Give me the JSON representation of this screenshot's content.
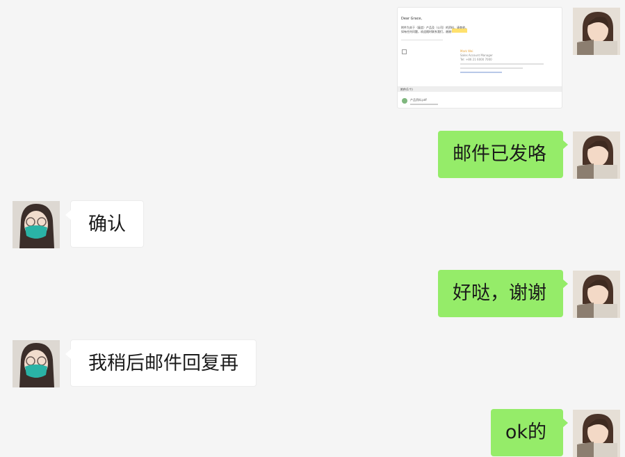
{
  "chat": {
    "messages": [
      {
        "side": "out",
        "type": "image",
        "email": {
          "greeting": "Dear Grace,",
          "body_line_1": "附件为关于（展会）产品及（公司）的资料，请查收。",
          "body_line_2": "如有任何问题，欢迎随时联系我们，谢谢！",
          "signature_name": "Mark Wei",
          "signature_line_1": "Sales Account Manager",
          "signature_line_2": "Tel: +86 21 6000 7000",
          "attachments_header": "附件(1个)",
          "attachment_name": "产品资料.pdf"
        }
      },
      {
        "side": "out",
        "type": "text",
        "text": "邮件已发咯"
      },
      {
        "side": "in",
        "type": "text",
        "text": "确认"
      },
      {
        "side": "out",
        "type": "text",
        "text": "好哒，谢谢"
      },
      {
        "side": "in",
        "type": "text",
        "text": "我稍后邮件回复再"
      },
      {
        "side": "out",
        "type": "text",
        "text": "ok的"
      }
    ]
  },
  "colors": {
    "background": "#f5f5f5",
    "outgoing_bubble": "#95ec69",
    "incoming_bubble": "#ffffff",
    "mask": "#2ab3a6"
  }
}
